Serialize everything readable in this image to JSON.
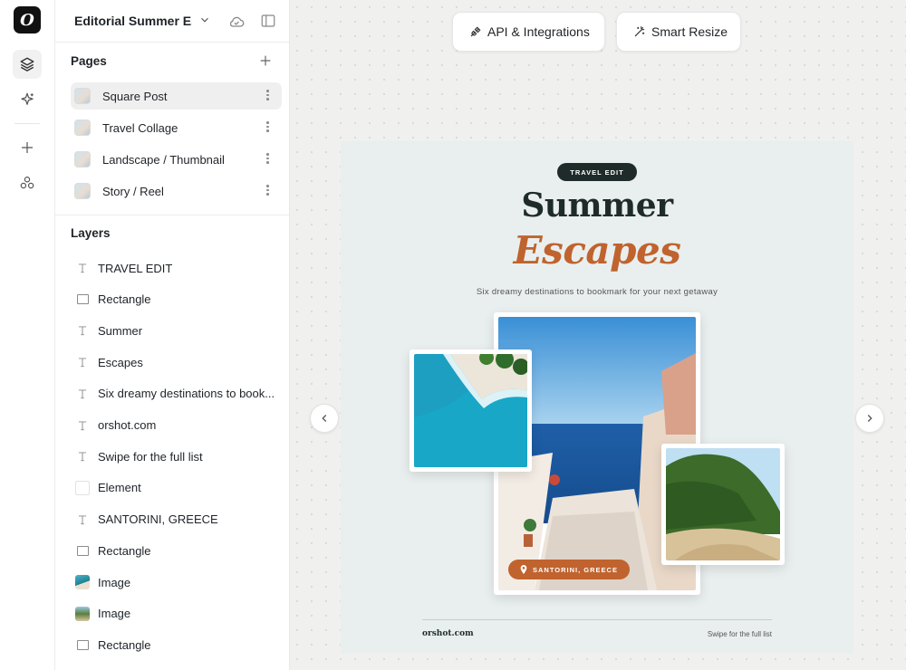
{
  "app": {
    "logo_glyph": "O"
  },
  "document": {
    "title": "Editorial Summer Es..."
  },
  "pages_section": {
    "title": "Pages",
    "items": [
      {
        "label": "Square Post",
        "selected": true
      },
      {
        "label": "Travel Collage",
        "selected": false
      },
      {
        "label": "Landscape / Thumbnail",
        "selected": false
      },
      {
        "label": "Story / Reel",
        "selected": false
      }
    ]
  },
  "layers_section": {
    "title": "Layers",
    "items": [
      {
        "label": "TRAVEL EDIT",
        "icon": "text-icon"
      },
      {
        "label": "Rectangle",
        "icon": "rectangle-icon"
      },
      {
        "label": "Summer",
        "icon": "text-icon"
      },
      {
        "label": "Escapes",
        "icon": "text-icon"
      },
      {
        "label": "Six dreamy destinations to book...",
        "icon": "text-icon"
      },
      {
        "label": "orshot.com",
        "icon": "text-icon"
      },
      {
        "label": "Swipe for the full list",
        "icon": "text-icon"
      },
      {
        "label": "Element",
        "icon": "element-icon"
      },
      {
        "label": "SANTORINI, GREECE",
        "icon": "text-icon"
      },
      {
        "label": "Rectangle",
        "icon": "rectangle-icon"
      },
      {
        "label": "Image",
        "icon": "image-icon"
      },
      {
        "label": "Image",
        "icon": "image-icon"
      },
      {
        "label": "Rectangle",
        "icon": "rectangle-icon"
      }
    ]
  },
  "toolbar": {
    "api_label": "API & Integrations",
    "resize_label": "Smart Resize"
  },
  "design": {
    "badge": "TRAVEL EDIT",
    "title_line1": "Summer",
    "title_line2": "Escapes",
    "subtitle": "Six dreamy destinations to bookmark for your next getaway",
    "location": "SANTORINI, GREECE",
    "footer_left": "orshot.com",
    "footer_right": "Swipe for the full list",
    "accent_color": "#c0632e",
    "dark_color": "#1f2b2b",
    "background_color": "#e9efee"
  }
}
